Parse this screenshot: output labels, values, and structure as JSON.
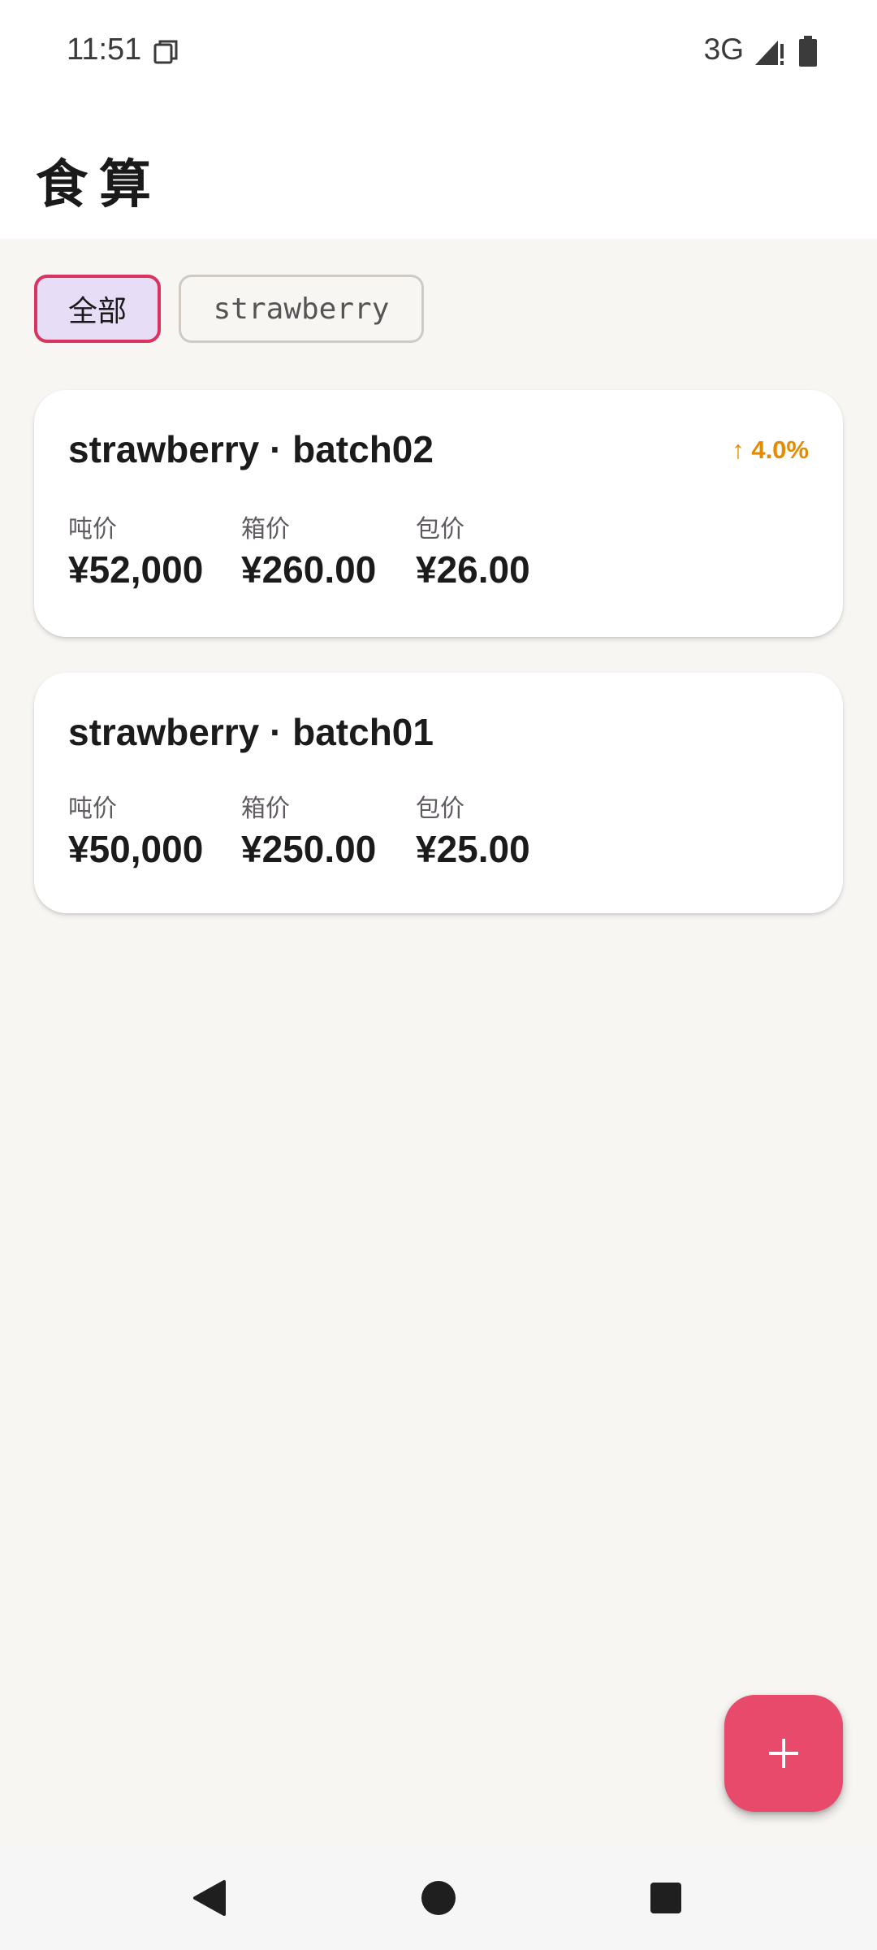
{
  "status_bar": {
    "time": "11:51",
    "network": "3G"
  },
  "app_bar": {
    "title": "食算"
  },
  "filters": [
    {
      "label": "全部",
      "selected": true
    },
    {
      "label": "strawberry",
      "selected": false
    }
  ],
  "items": [
    {
      "title": "strawberry · batch02",
      "change": "↑ 4.0%",
      "metrics": [
        {
          "label": "吨价",
          "value": "¥52,000"
        },
        {
          "label": "箱价",
          "value": "¥260.00"
        },
        {
          "label": "包价",
          "value": "¥26.00"
        }
      ]
    },
    {
      "title": "strawberry · batch01",
      "metrics": [
        {
          "label": "吨价",
          "value": "¥50,000"
        },
        {
          "label": "箱价",
          "value": "¥250.00"
        },
        {
          "label": "包价",
          "value": "¥25.00"
        }
      ]
    }
  ],
  "fab": {
    "icon": "plus-icon"
  },
  "colors": {
    "accent": "#d9335f",
    "fab": "#e84a6c",
    "chip_selected_bg": "#e8ddf7",
    "change_up": "#e68a00",
    "background": "#f7f6f3"
  }
}
